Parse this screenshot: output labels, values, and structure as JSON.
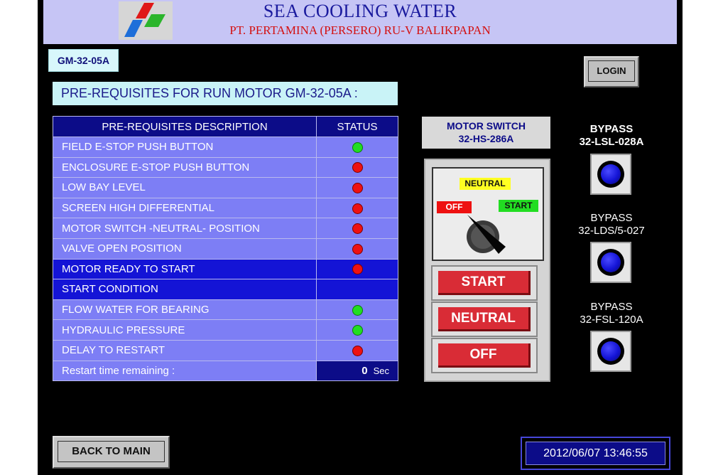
{
  "header": {
    "title": "SEA COOLING WATER",
    "subtitle": "PT. PERTAMINA (PERSERO) RU-V BALIKPAPAN"
  },
  "equipment_tag": "GM-32-05A",
  "prereq_title": "PRE-REQUISITES FOR RUN MOTOR GM-32-05A :",
  "table": {
    "headers": [
      "PRE-REQUISITES DESCRIPTION",
      "STATUS"
    ],
    "rows": [
      {
        "label": "FIELD E-STOP PUSH BUTTON",
        "status": "green"
      },
      {
        "label": "ENCLOSURE E-STOP PUSH BUTTON",
        "status": "red"
      },
      {
        "label": "LOW BAY LEVEL",
        "status": "red"
      },
      {
        "label": "SCREEN HIGH DIFFERENTIAL",
        "status": "red"
      },
      {
        "label": "MOTOR SWITCH -NEUTRAL- POSITION",
        "status": "red"
      },
      {
        "label": "VALVE OPEN POSITION",
        "status": "red"
      },
      {
        "label": "MOTOR READY TO START",
        "status": "red"
      },
      {
        "label": "START CONDITION",
        "status": "none"
      },
      {
        "label": "FLOW WATER FOR BEARING",
        "status": "green"
      },
      {
        "label": "HYDRAULIC PRESSURE",
        "status": "green"
      },
      {
        "label": "DELAY TO RESTART",
        "status": "red"
      }
    ],
    "timer_label": "Restart time remaining :",
    "timer_value": "0",
    "timer_unit": "Sec"
  },
  "motor_switch": {
    "label_line1": "MOTOR SWITCH",
    "label_line2": "32-HS-286A",
    "pos_neutral": "NEUTRAL",
    "pos_off": "OFF",
    "pos_start": "START",
    "btn_start": "START",
    "btn_neutral": "NEUTRAL",
    "btn_off": "OFF"
  },
  "login_label": "LOGIN",
  "bypass": [
    {
      "line1": "BYPASS",
      "line2": "32-LSL-028A"
    },
    {
      "line1": "BYPASS",
      "line2": "32-LDS/5-027"
    },
    {
      "line1": "BYPASS",
      "line2": "32-FSL-120A"
    }
  ],
  "back_label": "BACK TO MAIN",
  "datetime": "2012/06/07 13:46:55",
  "colors": {
    "status_green": "#22dd22",
    "status_red": "#ee1111",
    "accent_blue": "#0c0c88"
  }
}
